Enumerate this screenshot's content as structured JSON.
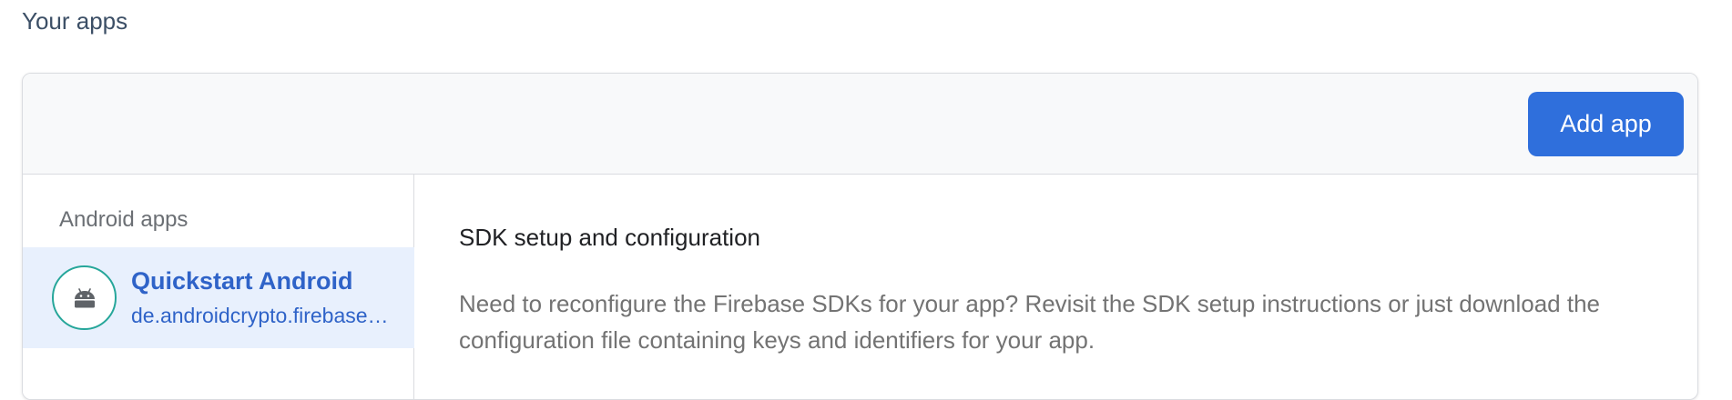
{
  "section_title": "Your apps",
  "header": {
    "add_app_label": "Add app"
  },
  "sidebar": {
    "heading": "Android apps",
    "apps": [
      {
        "name": "Quickstart Android",
        "package_id": "de.androidcrypto.firebase…",
        "icon": "android-icon",
        "selected": true
      }
    ]
  },
  "content": {
    "title": "SDK setup and configuration",
    "description": "Need to reconfigure the Firebase SDKs for your app? Revisit the SDK setup instructions or just download the configuration file containing keys and identifiers for your app."
  },
  "colors": {
    "accent": "#2f6fdc",
    "selected_bg": "#e8f0fd",
    "link_text": "#2f63c8",
    "avatar_ring": "#26a69a"
  }
}
